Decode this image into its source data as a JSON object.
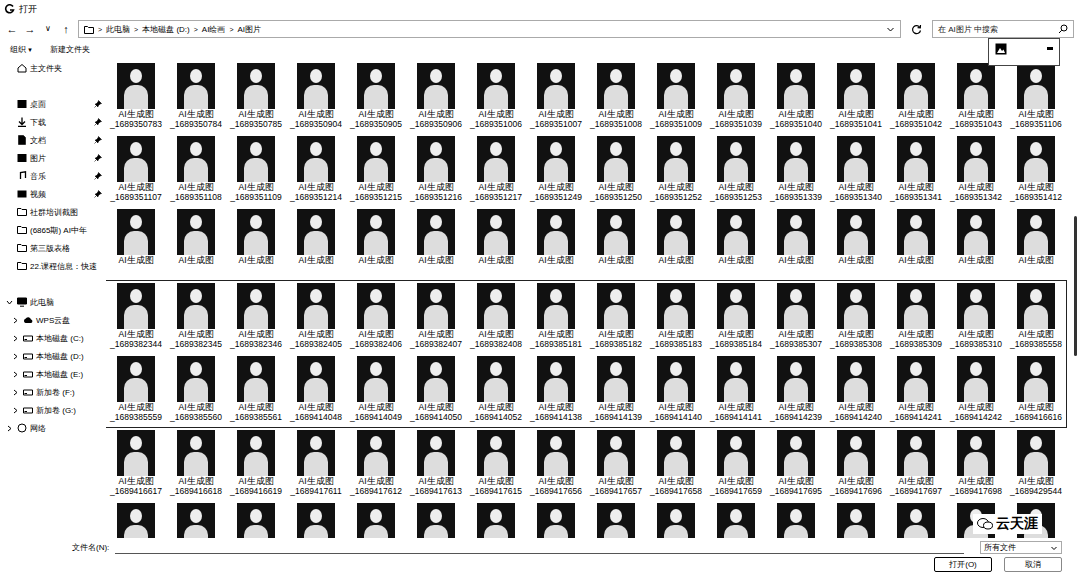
{
  "window": {
    "title": "打开"
  },
  "nav": {
    "back": "←",
    "forward": "→",
    "recent": "∨",
    "up": "↑"
  },
  "address": {
    "path": [
      "此电脑",
      "本地磁盘 (D:)",
      "AI绘画",
      "AI图片"
    ],
    "separator": ">"
  },
  "search": {
    "placeholder": "在 AI图片 中搜索"
  },
  "toolbar": {
    "organize": "组织",
    "organize_arrow": "▾",
    "new_folder": "新建文件夹"
  },
  "sidebar": {
    "sections": [
      {
        "items": [
          {
            "label": "主文件夹",
            "kind": "home",
            "pinned": false
          }
        ]
      },
      {
        "items": [
          {
            "label": "桌面",
            "kind": "desktop",
            "pinned": true
          },
          {
            "label": "下载",
            "kind": "download",
            "pinned": true
          },
          {
            "label": "文档",
            "kind": "document",
            "pinned": true
          },
          {
            "label": "图片",
            "kind": "picture",
            "pinned": true
          },
          {
            "label": "音乐",
            "kind": "music",
            "pinned": true
          },
          {
            "label": "视频",
            "kind": "video",
            "pinned": true
          },
          {
            "label": "社群培训截图",
            "kind": "folder",
            "pinned": false
          },
          {
            "label": "(6865期) AI中年",
            "kind": "folder",
            "pinned": false
          },
          {
            "label": "第三版表格",
            "kind": "folder",
            "pinned": false
          },
          {
            "label": "22.课程信息：快速",
            "kind": "folder",
            "pinned": false
          }
        ]
      },
      {
        "items": [
          {
            "label": "此电脑",
            "kind": "pc",
            "pinned": false,
            "expanded": true,
            "children": [
              {
                "label": "WPS云盘",
                "kind": "cloud",
                "expanded": false
              },
              {
                "label": "本地磁盘 (C:)",
                "kind": "drive",
                "expanded": false
              },
              {
                "label": "本地磁盘 (D:)",
                "kind": "drive",
                "expanded": false
              },
              {
                "label": "本地磁盘 (E:)",
                "kind": "drive",
                "expanded": false
              },
              {
                "label": "新加卷 (F:)",
                "kind": "drive",
                "expanded": false
              },
              {
                "label": "新加卷 (G:)",
                "kind": "drive",
                "expanded": false
              }
            ]
          },
          {
            "label": "网络",
            "kind": "network",
            "pinned": false,
            "expanded": false
          }
        ]
      }
    ]
  },
  "files": {
    "rows": [
      {
        "items": [
          {
            "name": "AI生成图",
            "number": "_1689350783",
            "selected": false
          },
          {
            "name": "AI生成图",
            "number": "_1689350784",
            "selected": false
          },
          {
            "name": "AI生成图",
            "number": "_1689350785",
            "selected": false
          },
          {
            "name": "AI生成图",
            "number": "_1689350904",
            "selected": false
          },
          {
            "name": "AI生成图",
            "number": "_1689350905",
            "selected": false
          },
          {
            "name": "AI生成图",
            "number": "_1689350906",
            "selected": false
          },
          {
            "name": "AI生成图",
            "number": "_1689351006",
            "selected": false
          },
          {
            "name": "AI生成图",
            "number": "_1689351007",
            "selected": false
          },
          {
            "name": "AI生成图",
            "number": "_1689351008",
            "selected": false
          },
          {
            "name": "AI生成图",
            "number": "_1689351009",
            "selected": false
          },
          {
            "name": "AI生成图",
            "number": "_1689351039",
            "selected": false
          },
          {
            "name": "AI生成图",
            "number": "_1689351040",
            "selected": false
          },
          {
            "name": "AI生成图",
            "number": "_1689351041",
            "selected": false
          },
          {
            "name": "AI生成图",
            "number": "_1689351042",
            "selected": false
          },
          {
            "name": "AI生成图",
            "number": "_1689351043",
            "selected": false
          },
          {
            "name": "AI生成图",
            "number": "_1689351106",
            "selected": false
          }
        ]
      },
      {
        "items": [
          {
            "name": "AI生成图",
            "number": "_1689351107",
            "selected": false
          },
          {
            "name": "AI生成图",
            "number": "_1689351108",
            "selected": false
          },
          {
            "name": "AI生成图",
            "number": "_1689351109",
            "selected": false
          },
          {
            "name": "AI生成图",
            "number": "_1689351214",
            "selected": false
          },
          {
            "name": "AI生成图",
            "number": "_1689351215",
            "selected": false
          },
          {
            "name": "AI生成图",
            "number": "_1689351216",
            "selected": false
          },
          {
            "name": "AI生成图",
            "number": "_1689351217",
            "selected": false
          },
          {
            "name": "AI生成图",
            "number": "_1689351249",
            "selected": false
          },
          {
            "name": "AI生成图",
            "number": "_1689351250",
            "selected": false
          },
          {
            "name": "AI生成图",
            "number": "_1689351252",
            "selected": false
          },
          {
            "name": "AI生成图",
            "number": "_1689351253",
            "selected": false
          },
          {
            "name": "AI生成图",
            "number": "_1689351339",
            "selected": false
          },
          {
            "name": "AI生成图",
            "number": "_1689351340",
            "selected": false
          },
          {
            "name": "AI生成图",
            "number": "_1689351341",
            "selected": false
          },
          {
            "name": "AI生成图",
            "number": "_1689351342",
            "selected": false
          },
          {
            "name": "AI生成图",
            "number": "_1689351412",
            "selected": false
          }
        ]
      },
      {
        "items": [
          {
            "name": "AI生成图",
            "selected": false
          },
          {
            "name": "AI生成图",
            "selected": false
          },
          {
            "name": "AI生成图",
            "selected": false
          },
          {
            "name": "AI生成图",
            "selected": false
          },
          {
            "name": "AI生成图",
            "selected": false
          },
          {
            "name": "AI生成图",
            "selected": false
          },
          {
            "name": "AI生成图",
            "selected": false
          },
          {
            "name": "AI生成图",
            "selected": false
          },
          {
            "name": "AI生成图",
            "selected": false
          },
          {
            "name": "AI生成图",
            "selected": false
          },
          {
            "name": "AI生成图",
            "selected": false
          },
          {
            "name": "AI生成图",
            "selected": false
          },
          {
            "name": "AI生成图",
            "selected": false
          },
          {
            "name": "AI生成图",
            "selected": false
          },
          {
            "name": "AI生成图",
            "selected": false
          },
          {
            "name": "AI生成图",
            "selected": false
          }
        ]
      },
      {
        "items": [
          {
            "name": "AI生成图",
            "number": "_1689382344",
            "selected": true
          },
          {
            "name": "AI生成图",
            "number": "_1689382345",
            "selected": true
          },
          {
            "name": "AI生成图",
            "number": "_1689382346",
            "selected": true
          },
          {
            "name": "AI生成图",
            "number": "_1689382405",
            "selected": true
          },
          {
            "name": "AI生成图",
            "number": "_1689382406",
            "selected": true
          },
          {
            "name": "AI生成图",
            "number": "_1689382407",
            "selected": true
          },
          {
            "name": "AI生成图",
            "number": "_1689382408",
            "selected": true
          },
          {
            "name": "AI生成图",
            "number": "_1689385181",
            "selected": true
          },
          {
            "name": "AI生成图",
            "number": "_1689385182",
            "selected": true
          },
          {
            "name": "AI生成图",
            "number": "_1689385183",
            "selected": true
          },
          {
            "name": "AI生成图",
            "number": "_1689385184",
            "selected": true
          },
          {
            "name": "AI生成图",
            "number": "_1689385307",
            "selected": true
          },
          {
            "name": "AI生成图",
            "number": "_1689385308",
            "selected": true
          },
          {
            "name": "AI生成图",
            "number": "_1689385309",
            "selected": true
          },
          {
            "name": "AI生成图",
            "number": "_1689385310",
            "selected": true
          },
          {
            "name": "AI生成图",
            "number": "_1689385558",
            "selected": true
          }
        ]
      },
      {
        "items": [
          {
            "name": "AI生成图",
            "number": "_1689385559",
            "selected": true
          },
          {
            "name": "AI生成图",
            "number": "_1689385560",
            "selected": true
          },
          {
            "name": "AI生成图",
            "number": "_1689385561",
            "selected": true
          },
          {
            "name": "AI生成图",
            "number": "_1689414048",
            "selected": true
          },
          {
            "name": "AI生成图",
            "number": "_1689414049",
            "selected": true
          },
          {
            "name": "AI生成图",
            "number": "_1689414050",
            "selected": true
          },
          {
            "name": "AI生成图",
            "number": "_1689414052",
            "selected": true
          },
          {
            "name": "AI生成图",
            "number": "_1689414138",
            "selected": true
          },
          {
            "name": "AI生成图",
            "number": "_1689414139",
            "selected": true
          },
          {
            "name": "AI生成图",
            "number": "_1689414140",
            "selected": true
          },
          {
            "name": "AI生成图",
            "number": "_1689414141",
            "selected": true
          },
          {
            "name": "AI生成图",
            "number": "_1689414239",
            "selected": true
          },
          {
            "name": "AI生成图",
            "number": "_1689414240",
            "selected": true
          },
          {
            "name": "AI生成图",
            "number": "_1689414241",
            "selected": true
          },
          {
            "name": "AI生成图",
            "number": "_1689414242",
            "selected": true
          },
          {
            "name": "AI生成图",
            "number": "_1689416616",
            "selected": true
          }
        ]
      },
      {
        "items": [
          {
            "name": "AI生成图",
            "number": "_1689416617",
            "selected": false
          },
          {
            "name": "AI生成图",
            "number": "_1689416618",
            "selected": false
          },
          {
            "name": "AI生成图",
            "number": "_1689416619",
            "selected": false
          },
          {
            "name": "AI生成图",
            "number": "_1689417611",
            "selected": false
          },
          {
            "name": "AI生成图",
            "number": "_1689417612",
            "selected": false
          },
          {
            "name": "AI生成图",
            "number": "_1689417613",
            "selected": false
          },
          {
            "name": "AI生成图",
            "number": "_1689417615",
            "selected": false
          },
          {
            "name": "AI生成图",
            "number": "_1689417656",
            "selected": false
          },
          {
            "name": "AI生成图",
            "number": "_1689417657",
            "selected": false
          },
          {
            "name": "AI生成图",
            "number": "_1689417658",
            "selected": false
          },
          {
            "name": "AI生成图",
            "number": "_1689417659",
            "selected": false
          },
          {
            "name": "AI生成图",
            "number": "_1689417695",
            "selected": false
          },
          {
            "name": "AI生成图",
            "number": "_1689417696",
            "selected": false
          },
          {
            "name": "AI生成图",
            "number": "_1689417697",
            "selected": false
          },
          {
            "name": "AI生成图",
            "number": "_1689417698",
            "selected": false
          },
          {
            "name": "AI生成图",
            "number": "_1689429544",
            "selected": false
          }
        ]
      },
      {
        "items": [
          {
            "selected": false
          },
          {
            "selected": false
          },
          {
            "selected": false
          },
          {
            "selected": false
          },
          {
            "selected": false
          },
          {
            "selected": false
          },
          {
            "selected": false
          },
          {
            "selected": false
          },
          {
            "selected": false
          },
          {
            "selected": false
          },
          {
            "selected": false
          },
          {
            "selected": false
          },
          {
            "selected": false
          },
          {
            "selected": false
          },
          {
            "selected": false
          },
          {
            "selected": false
          }
        ]
      }
    ]
  },
  "scrollbar": {
    "thumb_start": 0.33,
    "thumb_size": 0.29
  },
  "footer": {
    "filename_label": "文件名(N):",
    "filetype": "所有文件",
    "buttons": [
      {
        "label": "打开(O)",
        "primary": true
      },
      {
        "label": "取消",
        "primary": false
      }
    ]
  },
  "watermark": {
    "text": "云天涯"
  }
}
